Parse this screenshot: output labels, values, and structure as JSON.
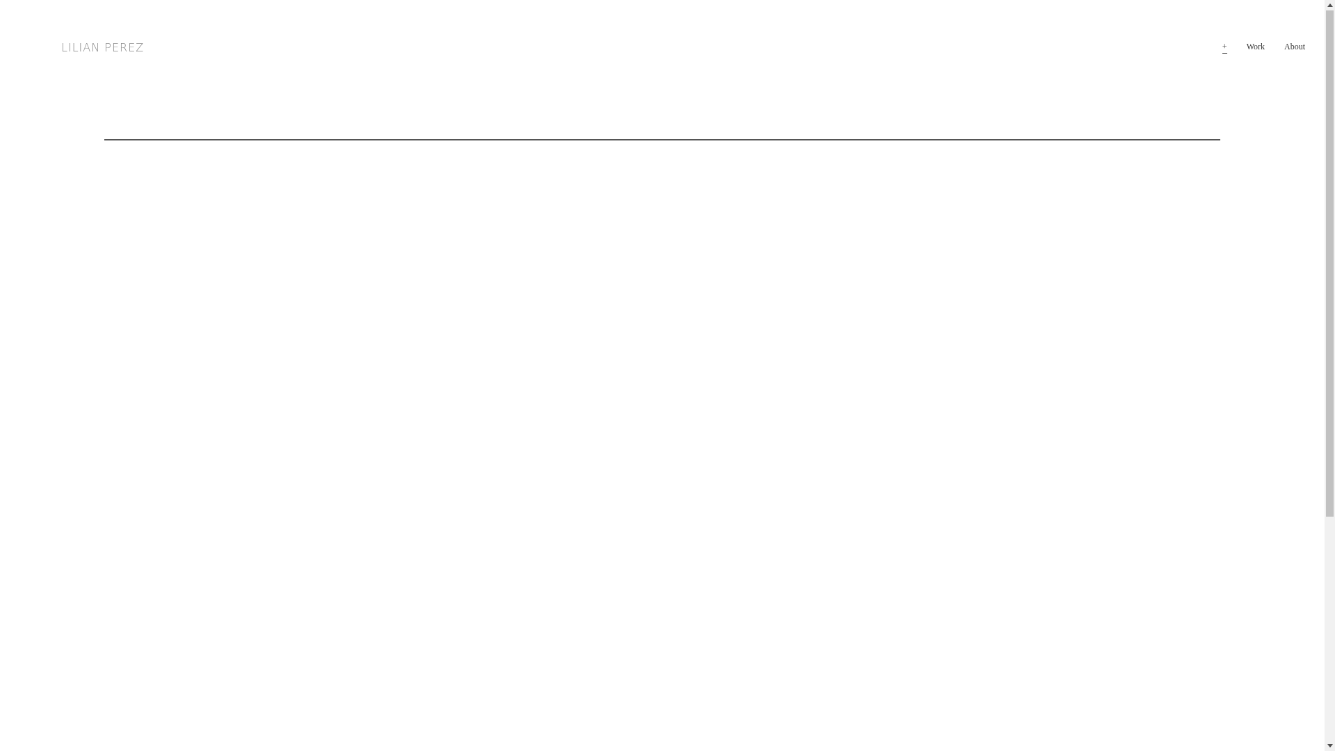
{
  "logo": "LILIAN PEREZ",
  "nav": [
    {
      "label": "+",
      "selected": true
    },
    {
      "label": "Work",
      "selected": false
    },
    {
      "label": "About",
      "selected": false
    }
  ]
}
